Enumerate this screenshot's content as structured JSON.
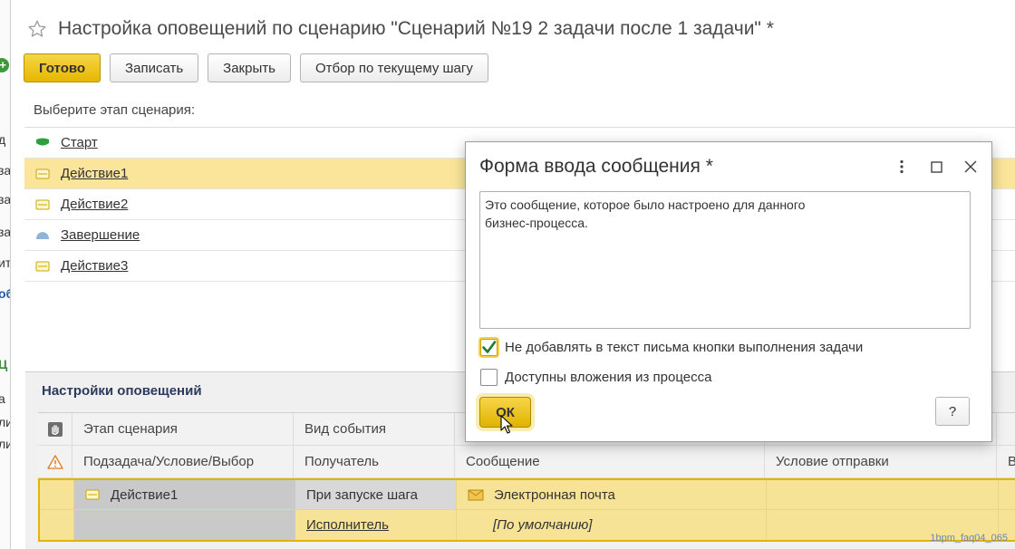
{
  "page": {
    "title": "Настройка оповещений по сценарию \"Сценарий №19 2 задачи после 1 задачи\" *"
  },
  "toolbar": {
    "done_label": "Готово",
    "save_label": "Записать",
    "close_label": "Закрыть",
    "filter_label": "Отбор по текущему шагу"
  },
  "stages": {
    "prompt": "Выберите этап сценария:",
    "items": [
      {
        "label": "Старт",
        "icon": "start-icon"
      },
      {
        "label": "Действие1",
        "icon": "action-icon",
        "selected": true
      },
      {
        "label": "Действие2",
        "icon": "action-icon"
      },
      {
        "label": "Завершение",
        "icon": "finish-icon"
      },
      {
        "label": "Действие3",
        "icon": "action-icon"
      }
    ]
  },
  "notifications": {
    "title": "Настройки оповещений",
    "header_row1": [
      "Этап сценария",
      "Вид события"
    ],
    "header_row2": [
      "Подзадача/Условие/Выбор",
      "Получатель",
      "Сообщение",
      "Условие отправки",
      "В"
    ],
    "rows": [
      {
        "stage": "Действие1",
        "event": "При запуске шага",
        "message_type": "Электронная почта",
        "recipient": "Исполнитель",
        "message": "[По умолчанию]"
      }
    ]
  },
  "modal": {
    "title": "Форма ввода сообщения *",
    "message_text": "Это сообщение, которое было настроено для данного\nбизнес-процесса.",
    "checkbox1_label": "Не добавлять в текст письма кнопки выполнения задачи",
    "checkbox1_checked": true,
    "checkbox2_label": "Доступны вложения из процесса",
    "checkbox2_checked": false,
    "ok_label": "ОК",
    "help_label": "?"
  },
  "background_window": {
    "fragments": [
      "д",
      "за",
      "за",
      "за",
      "ит",
      "об",
      "Ц",
      "а",
      "ли",
      "ли"
    ]
  },
  "watermark": "1bpm_faq04_065",
  "colors": {
    "accent_yellow": "#f2c200",
    "selection_yellow": "#fbe59a",
    "title_blue": "#2b3a5a"
  }
}
